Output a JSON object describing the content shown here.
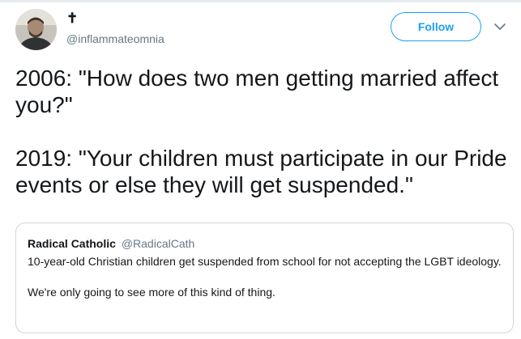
{
  "colors": {
    "accent": "#1da1f2",
    "text_primary": "#14171a",
    "text_secondary": "#657786",
    "border": "#ccd6dd"
  },
  "tweet": {
    "display_name": "✝",
    "handle": "@inflammateomnia",
    "follow_label": "Follow",
    "caret_icon": "chevron-down-icon",
    "text_paragraphs": [
      "2006: \"How does two men getting married affect you?\"",
      "2019: \"Your children must participate in our Pride events or else they will get suspended.\""
    ]
  },
  "quote": {
    "name": "Radical Catholic",
    "handle": "@RadicalCath",
    "paragraphs": [
      "10-year-old Christian children get suspended from school for not accepting the LGBT ideology.",
      "We're only going to see more of this kind of thing."
    ]
  }
}
